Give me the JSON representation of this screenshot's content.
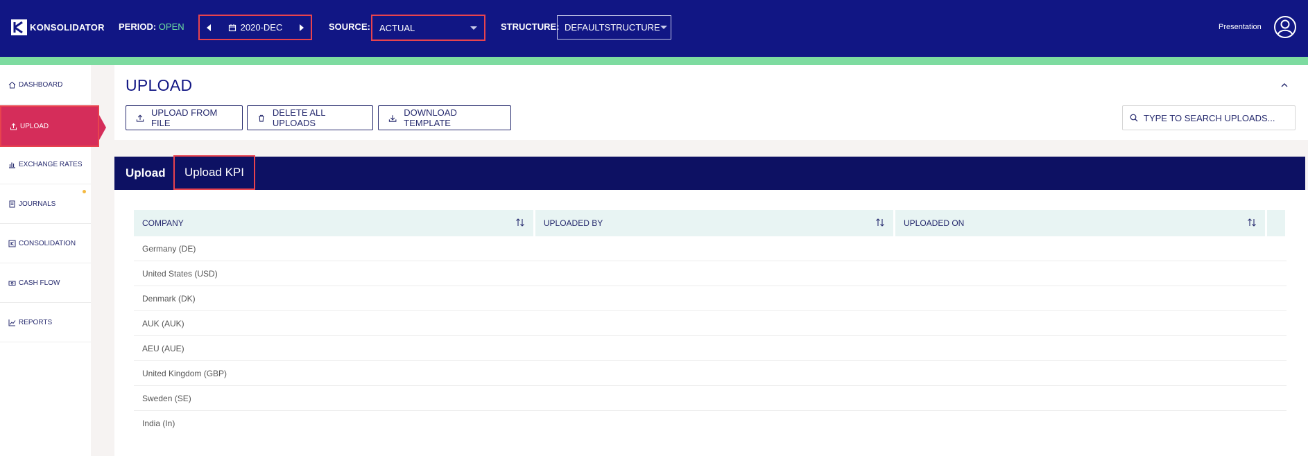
{
  "header": {
    "brand": "KONSOLIDATOR",
    "period_label": "PERIOD:",
    "period_status": "OPEN",
    "period_value": "2020-DEC",
    "source_label": "SOURCE:",
    "source_value": "ACTUAL",
    "structure_label": "STRUCTURE:",
    "structure_value": "DEFAULTSTRUCTURE",
    "user_name": "Presentation"
  },
  "sidebar": {
    "items": [
      {
        "label": "DASHBOARD",
        "icon": "home-icon"
      },
      {
        "label": "UPLOAD",
        "icon": "upload-icon"
      },
      {
        "label": "EXCHANGE RATES",
        "icon": "bar-chart-icon"
      },
      {
        "label": "JOURNALS",
        "icon": "document-icon"
      },
      {
        "label": "CONSOLIDATION",
        "icon": "konsolidator-icon"
      },
      {
        "label": "CASH FLOW",
        "icon": "cash-icon"
      },
      {
        "label": "REPORTS",
        "icon": "line-chart-icon"
      }
    ],
    "active": "UPLOAD"
  },
  "page": {
    "title": "UPLOAD",
    "buttons": {
      "upload_from_file": "UPLOAD FROM FILE",
      "delete_all": "DELETE ALL UPLOADS",
      "download_template": "DOWNLOAD TEMPLATE"
    },
    "search_placeholder": "TYPE TO SEARCH UPLOADS..."
  },
  "tabs": [
    {
      "label": "Upload",
      "selected": true
    },
    {
      "label": "Upload KPI",
      "selected": false
    }
  ],
  "table": {
    "columns": [
      "COMPANY",
      "UPLOADED BY",
      "UPLOADED ON"
    ],
    "rows": [
      [
        "Germany (DE)",
        "",
        ""
      ],
      [
        "United States (USD)",
        "",
        ""
      ],
      [
        "Denmark (DK)",
        "",
        ""
      ],
      [
        "AUK (AUK)",
        "",
        ""
      ],
      [
        "AEU (AUE)",
        "",
        ""
      ],
      [
        "United Kingdom (GBP)",
        "",
        ""
      ],
      [
        "Sweden (SE)",
        "",
        ""
      ],
      [
        "India (In)",
        "",
        ""
      ]
    ]
  },
  "colors": {
    "header_bg": "#111684",
    "accent_green": "#7ddba0",
    "active_nav": "#d52d5a",
    "tabbar_bg": "#0d1163",
    "highlight": "#e8434e"
  }
}
